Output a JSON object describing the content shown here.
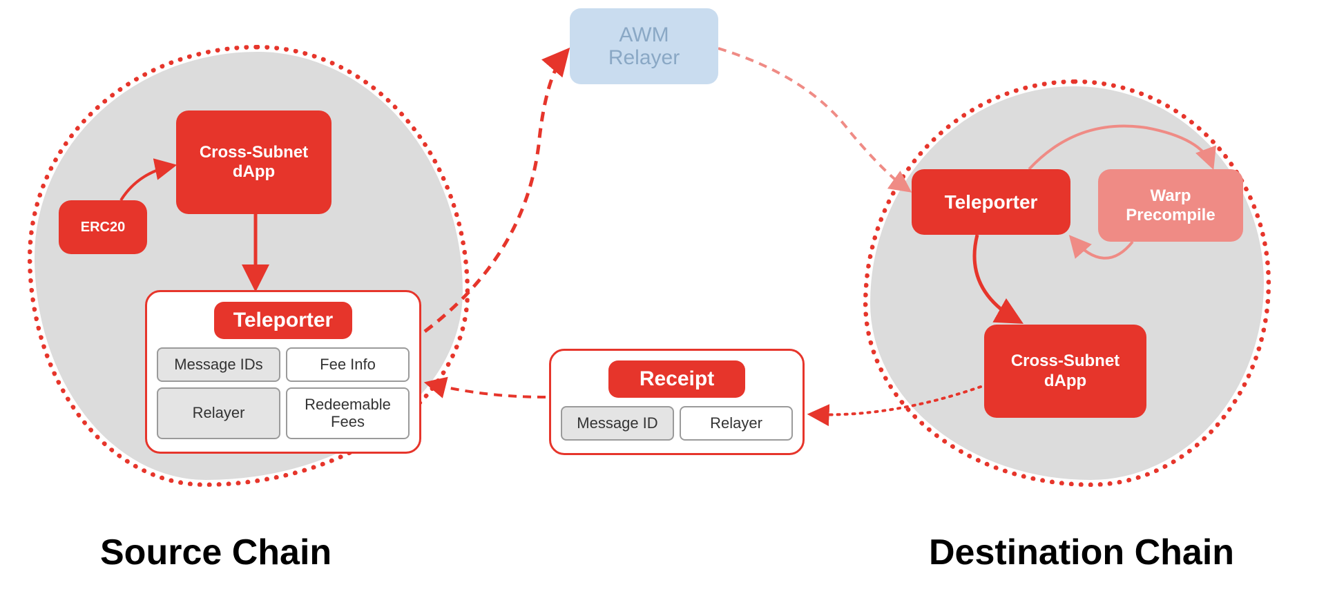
{
  "source_chain": {
    "title": "Source Chain",
    "erc20": "ERC20",
    "dapp": "Cross-Subnet\ndApp",
    "teleporter": {
      "title": "Teleporter",
      "cells": {
        "message_ids": "Message IDs",
        "fee_info": "Fee Info",
        "relayer": "Relayer",
        "redeemable_fees": "Redeemable\nFees"
      }
    }
  },
  "awm_relayer": "AWM\nRelayer",
  "receipt": {
    "title": "Receipt",
    "cells": {
      "message_id": "Message ID",
      "relayer": "Relayer"
    }
  },
  "destination_chain": {
    "title": "Destination Chain",
    "teleporter": "Teleporter",
    "warp_precompile": "Warp\nPrecompile",
    "dapp": "Cross-Subnet\ndApp"
  },
  "colors": {
    "red": "#e6352b",
    "faded_red": "#ef8b85",
    "blue": "#c9dcef",
    "grey_blob": "#dcdcdc"
  }
}
